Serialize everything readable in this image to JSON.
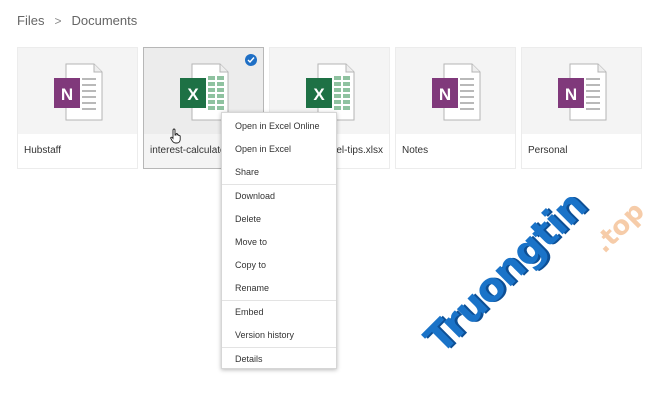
{
  "breadcrumb": {
    "root": "Files",
    "current": "Documents"
  },
  "files": [
    {
      "name": "Hubstaff",
      "icon": "onenote-icon"
    },
    {
      "name": "interest-calculato",
      "icon": "excel-icon",
      "selected": true
    },
    {
      "name": "cel-tips.xlsx",
      "icon": "excel-icon"
    },
    {
      "name": "Notes",
      "icon": "onenote-icon"
    },
    {
      "name": "Personal",
      "icon": "onenote-icon"
    }
  ],
  "context_menu": {
    "items": [
      "Open in Excel Online",
      "Open in Excel",
      "Share",
      "Download",
      "Delete",
      "Move to",
      "Copy to",
      "Rename",
      "Embed",
      "Version history",
      "Details"
    ]
  },
  "watermark": {
    "main": "Truongtin",
    "suffix": ".top"
  },
  "colors": {
    "onenote": "#80397b",
    "excel": "#1e7145",
    "accent": "#1f6fc5",
    "watermark": "#1a73c8"
  }
}
